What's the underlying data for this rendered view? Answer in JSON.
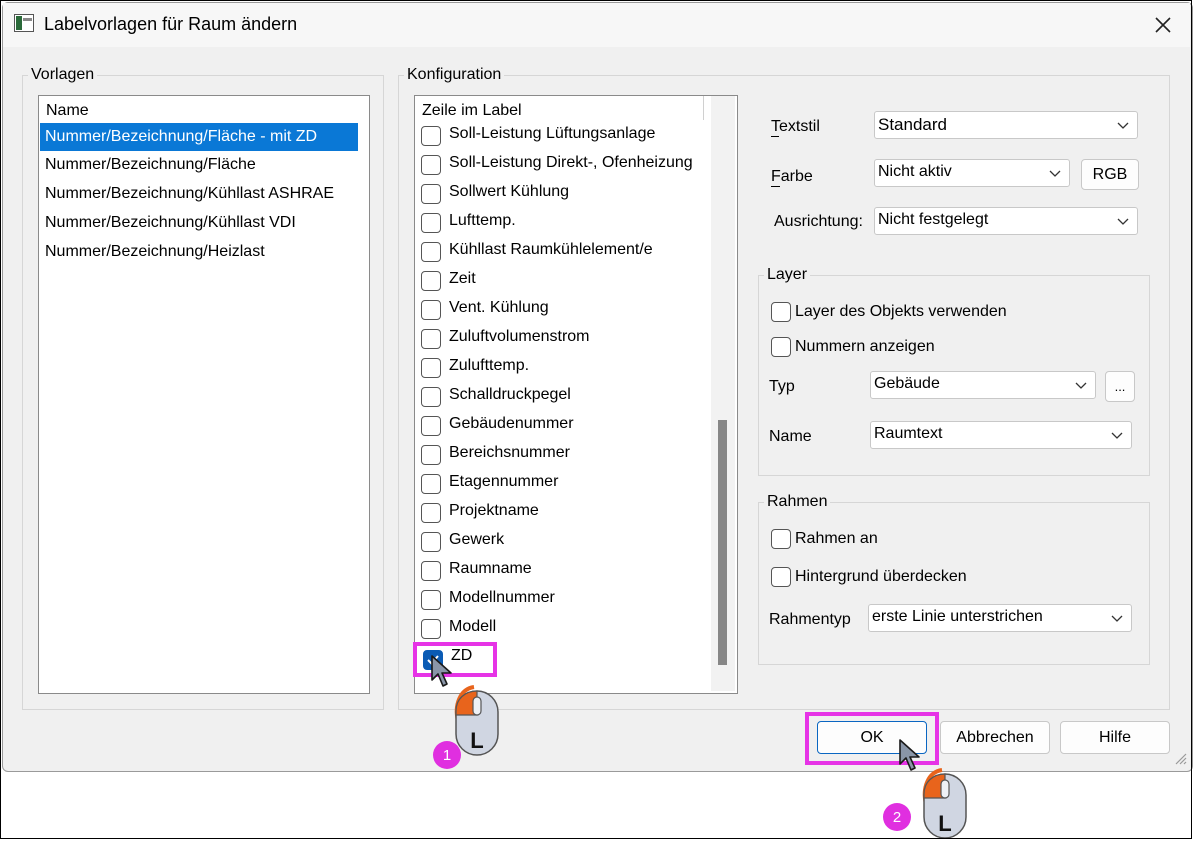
{
  "dialog": {
    "title": "Labelvorlagen für Raum ändern"
  },
  "vorlagen": {
    "group_label": "Vorlagen",
    "column_header": "Name",
    "items": [
      {
        "label": "Nummer/Bezeichnung/Fläche - mit ZD",
        "selected": true
      },
      {
        "label": "Nummer/Bezeichnung/Fläche",
        "selected": false
      },
      {
        "label": "Nummer/Bezeichnung/Kühllast ASHRAE",
        "selected": false
      },
      {
        "label": "Nummer/Bezeichnung/Kühllast VDI",
        "selected": false
      },
      {
        "label": "Nummer/Bezeichnung/Heizlast",
        "selected": false
      }
    ]
  },
  "konfiguration": {
    "group_label": "Konfiguration",
    "column_header": "Zeile im Label",
    "rows": [
      {
        "label": "Soll-Leistung Lüftungsanlage",
        "checked": false
      },
      {
        "label": "Soll-Leistung Direkt-, Ofenheizung",
        "checked": false
      },
      {
        "label": "Sollwert Kühlung",
        "checked": false
      },
      {
        "label": "Lufttemp.",
        "checked": false
      },
      {
        "label": "Kühllast Raumkühlelement/e",
        "checked": false
      },
      {
        "label": "Zeit",
        "checked": false
      },
      {
        "label": "Vent. Kühlung",
        "checked": false
      },
      {
        "label": "Zuluftvolumenstrom",
        "checked": false
      },
      {
        "label": "Zulufttemp.",
        "checked": false
      },
      {
        "label": "Schalldruckpegel",
        "checked": false
      },
      {
        "label": "Gebäudenummer",
        "checked": false
      },
      {
        "label": "Bereichsnummer",
        "checked": false
      },
      {
        "label": "Etagennummer",
        "checked": false
      },
      {
        "label": "Projektname",
        "checked": false
      },
      {
        "label": "Gewerk",
        "checked": false
      },
      {
        "label": "Raumname",
        "checked": false
      },
      {
        "label": "Modellnummer",
        "checked": false
      },
      {
        "label": "Modell",
        "checked": false
      },
      {
        "label": "ZD",
        "checked": true
      }
    ]
  },
  "properties": {
    "textstil_label": "Textstil",
    "textstil_value": "Standard",
    "farbe_label": "Farbe",
    "farbe_value": "Nicht aktiv",
    "rgb_button": "RGB",
    "ausrichtung_label": "Ausrichtung:",
    "ausrichtung_value": "Nicht festgelegt"
  },
  "layer": {
    "group_label": "Layer",
    "use_object_layer_label": "Layer des Objekts verwenden",
    "show_numbers_label": "Nummern anzeigen",
    "typ_label": "Typ",
    "typ_value": "Gebäude",
    "browse_button": "...",
    "name_label": "Name",
    "name_value": "Raumtext"
  },
  "rahmen": {
    "group_label": "Rahmen",
    "frame_on_label": "Rahmen an",
    "cover_background_label": "Hintergrund überdecken",
    "rahmentyp_label": "Rahmentyp",
    "rahmentyp_value": "erste Linie unterstrichen"
  },
  "buttons": {
    "ok": "OK",
    "cancel": "Abbrechen",
    "help": "Hilfe"
  },
  "annotations": {
    "step1": "1",
    "step2": "2",
    "mouse_button_letter": "L",
    "highlight_color": "#e633e6",
    "mouse_accent_color": "#e8641c"
  },
  "colors": {
    "selection": "#0a78d6",
    "checkbox_checked": "#0a5bb4"
  }
}
